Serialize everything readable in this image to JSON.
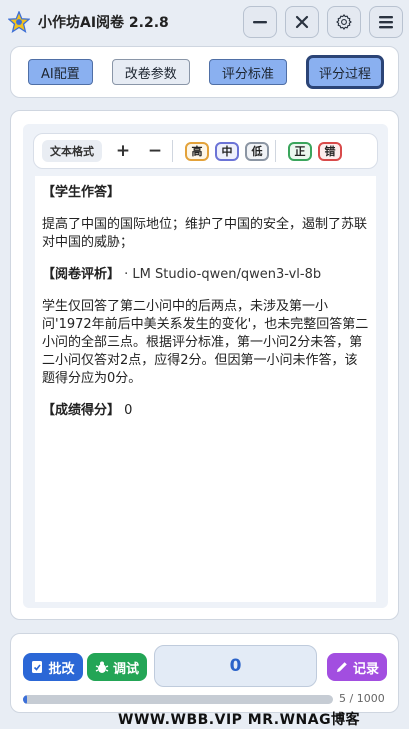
{
  "app": {
    "title": "小作坊AI阅卷 2.2.8"
  },
  "window_controls": {
    "minimize_icon": "minus",
    "close_icon": "x",
    "settings_icon": "gear",
    "menu_icon": "hamburger"
  },
  "tabs": [
    {
      "label": "AI配置",
      "state": "blue"
    },
    {
      "label": "改卷参数",
      "state": "default"
    },
    {
      "label": "评分标准",
      "state": "blue"
    },
    {
      "label": "评分过程",
      "state": "active"
    }
  ],
  "toolbar": {
    "text_format_label": "文本格式",
    "plus_label": "+",
    "minus_label": "−",
    "tags": [
      {
        "label": "高",
        "color": "#e3a23a"
      },
      {
        "label": "中",
        "color": "#6b73d6"
      },
      {
        "label": "低",
        "color": "#8b95a3"
      },
      {
        "label": "正",
        "color": "#3aa55c"
      },
      {
        "label": "错",
        "color": "#d84a4a"
      }
    ]
  },
  "content": {
    "answer_title": "【学生作答】",
    "answer_text": "提高了中国的国际地位；维护了中国的安全，遏制了苏联对中国的威胁；",
    "review_title": "【阅卷评析】",
    "review_model": "· LM Studio-qwen/qwen3-vl-8b",
    "review_text": "学生仅回答了第二小问中的后两点，未涉及第一小问'1972年前后中美关系发生的变化'，也未完整回答第二小问的全部三点。根据评分标准，第一小问2分未答，第二小问仅答对2点，应得2分。但因第一小问未作答，该题得分应为0分。",
    "score_title": "【成绩得分】",
    "score_value": "0"
  },
  "bottom": {
    "pigai_label": "批改",
    "tiaoshi_label": "调试",
    "score_display": "0",
    "jilu_label": "记录",
    "progress_current": 5,
    "progress_total": 1000,
    "progress_text": "5 / 1000",
    "colors": {
      "pigai": "#2b67d6",
      "tiaoshi": "#23a556",
      "jilu": "#a24ee0"
    }
  },
  "watermark": "WWW.WBB.VIP   MR.WNAG博客"
}
